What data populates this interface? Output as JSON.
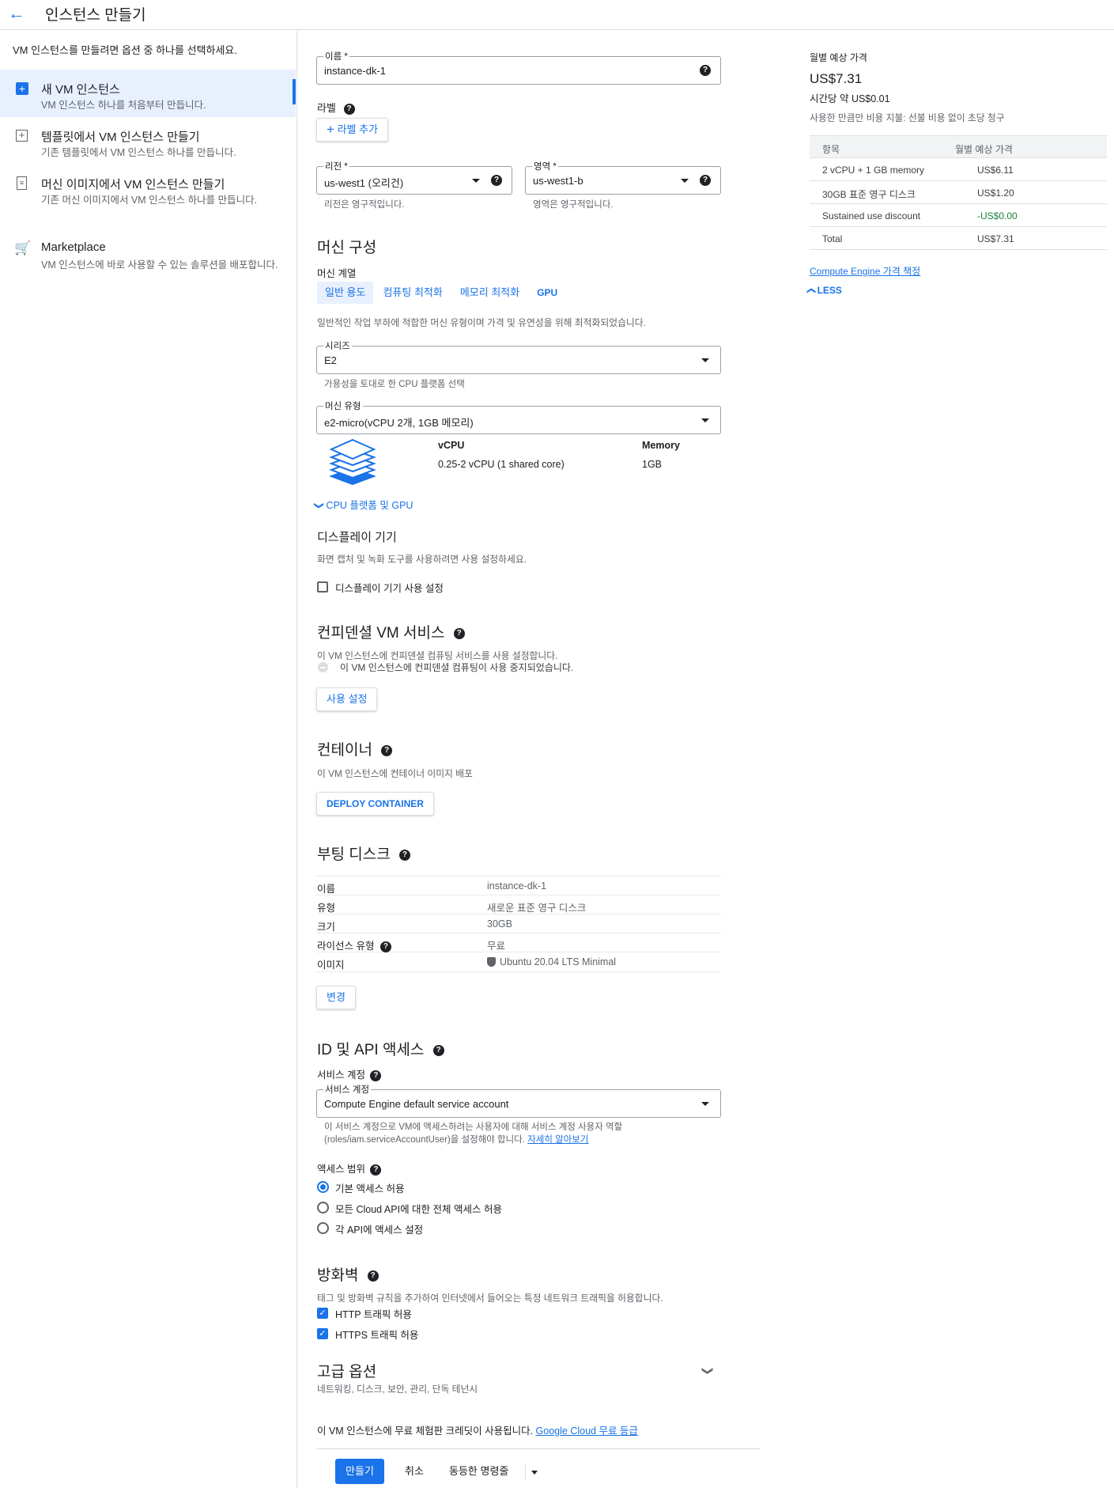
{
  "header": {
    "title": "인스턴스 만들기"
  },
  "left": {
    "intro": "VM 인스턴스를 만들려면 옵션 중 하나를 선택하세요.",
    "options": [
      {
        "title": "새 VM 인스턴스",
        "desc": "VM 인스턴스 하나를 처음부터 만듭니다."
      },
      {
        "title": "템플릿에서 VM 인스턴스 만들기",
        "desc": "기존 템플릿에서 VM 인스턴스 하나를 만듭니다."
      },
      {
        "title": "머신 이미지에서 VM 인스턴스 만들기",
        "desc": "기존 머신 이미지에서 VM 인스턴스 하나를 만듭니다."
      },
      {
        "title": "Marketplace",
        "desc": "VM 인스턴스에 바로 사용할 수 있는 솔루션을 배포합니다."
      }
    ]
  },
  "form": {
    "name": {
      "label": "이름 *",
      "value": "instance-dk-1"
    },
    "labels": {
      "title": "라벨",
      "add": "라벨 추가"
    },
    "region": {
      "label": "리전 *",
      "value": "us-west1 (오리건)",
      "hint": "리전은 영구적입니다."
    },
    "zone": {
      "label": "영역 *",
      "value": "us-west1-b",
      "hint": "영역은 영구적입니다."
    },
    "machine": {
      "title": "머신 구성",
      "family_label": "머신 계열",
      "tabs": [
        "일반 용도",
        "컴퓨팅 최적화",
        "메모리 최적화",
        "GPU"
      ],
      "desc": "일반적인 작업 부하에 적합한 머신 유형이며 가격 및 유연성을 위해 최적화되었습니다.",
      "series": {
        "label": "시리즈",
        "value": "E2",
        "hint": "가용성을 토대로 한 CPU 플랫폼 선택"
      },
      "type": {
        "label": "머신 유형",
        "value": "e2-micro(vCPU 2개, 1GB 메모리)"
      },
      "vcpu_label": "vCPU",
      "vcpu_value": "0.25-2 vCPU (1 shared core)",
      "mem_label": "Memory",
      "mem_value": "1GB",
      "cpu_toggle": "CPU 플랫폼 및 GPU"
    },
    "display": {
      "title": "디스플레이 기기",
      "desc": "화면 캡처 및 녹화 도구를 사용하려면 사용 설정하세요.",
      "checkbox": "디스플레이 기기 사용 설정"
    },
    "confidential": {
      "title": "컨피덴셜 VM 서비스",
      "desc": "이 VM 인스턴스에 컨피덴셜 컴퓨팅 서비스를 사용 설정합니다.",
      "status": "이 VM 인스턴스에 컨피덴셜 컴퓨팅이 사용 중지되었습니다.",
      "button": "사용 설정"
    },
    "container": {
      "title": "컨테이너",
      "desc": "이 VM 인스턴스에 컨테이너 이미지 배포",
      "button": "DEPLOY CONTAINER"
    },
    "boot": {
      "title": "부팅 디스크",
      "rows": [
        {
          "k": "이름",
          "v": "instance-dk-1"
        },
        {
          "k": "유형",
          "v": "새로운 표준 영구 디스크"
        },
        {
          "k": "크기",
          "v": "30GB"
        },
        {
          "k": "라이선스 유형",
          "v": "무료"
        },
        {
          "k": "이미지",
          "v": "Ubuntu 20.04 LTS Minimal"
        }
      ],
      "button": "변경"
    },
    "identity": {
      "title": "ID 및 API 액세스",
      "sa_title": "서비스 계정",
      "sa": {
        "label": "서비스 계정",
        "value": "Compute Engine default service account"
      },
      "sa_hint1": "이 서비스 계정으로 VM에 액세스하려는 사용자에 대해 서비스 계정 사용자 역할",
      "sa_hint2": "(roles/iam.serviceAccountUser)을 설정해야 합니다.",
      "sa_link": "자세히 알아보기",
      "scope_title": "액세스 범위",
      "scopes": [
        "기본 액세스 허용",
        "모든 Cloud API에 대한 전체 액세스 허용",
        "각 API에 액세스 설정"
      ]
    },
    "firewall": {
      "title": "방화벽",
      "desc": "태그 및 방화벽 규칙을 추가하여 인터넷에서 들어오는 특정 네트워크 트래픽을 허용합니다.",
      "http": "HTTP 트래픽 허용",
      "https": "HTTPS 트래픽 허용"
    },
    "advanced": {
      "title": "고급 옵션",
      "desc": "네트워킹, 디스크, 보안, 관리, 단독 테넌시"
    },
    "credit": {
      "text": "이 VM 인스턴스에 무료 체험판 크레딧이 사용됩니다.",
      "link": "Google Cloud 무료 등급"
    },
    "actions": {
      "create": "만들기",
      "cancel": "취소",
      "equiv": "동등한 명령줄"
    }
  },
  "pricing": {
    "title": "월별 예상 가격",
    "total": "US$7.31",
    "hourly": "시간당 약 US$0.01",
    "note": "사용한 만큼만 비용 지불: 선불 비용 없이 초당 청구",
    "col_item": "항목",
    "col_price": "월별 예상 가격",
    "rows": [
      {
        "k": "2 vCPU + 1 GB memory",
        "v": "US$6.11"
      },
      {
        "k": "30GB 표준 영구 디스크",
        "v": "US$1.20"
      },
      {
        "k": "Sustained use discount",
        "v": "-US$0.00"
      },
      {
        "k": "Total",
        "v": "US$7.31"
      }
    ],
    "link": "Compute Engine 가격 책정",
    "less": "LESS"
  },
  "colors": {
    "accent": "#1a73e8",
    "selected_bg": "#e8f0fe",
    "discount": "#188038"
  }
}
